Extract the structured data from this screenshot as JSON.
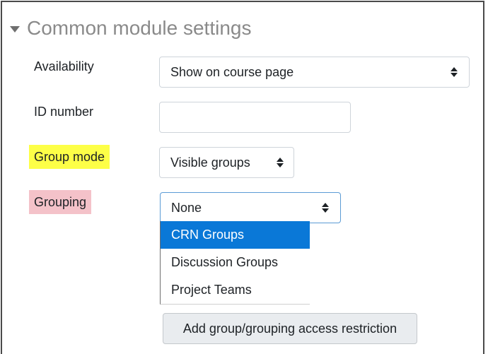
{
  "section": {
    "title": "Common module settings"
  },
  "fields": {
    "availability": {
      "label": "Availability",
      "value": "Show on course page"
    },
    "id_number": {
      "label": "ID number",
      "value": ""
    },
    "group_mode": {
      "label": "Group mode",
      "value": "Visible groups",
      "highlight": "#fdff47"
    },
    "grouping": {
      "label": "Grouping",
      "value": "None",
      "highlight": "#f4c2c9",
      "options": [
        "CRN Groups",
        "Discussion Groups",
        "Project Teams"
      ],
      "highlighted_option": "CRN Groups"
    }
  },
  "actions": {
    "add_restriction_label": "Add group/grouping access restriction"
  },
  "colors": {
    "accent": "#0a78d7",
    "focus_border": "#5b9bd5"
  }
}
